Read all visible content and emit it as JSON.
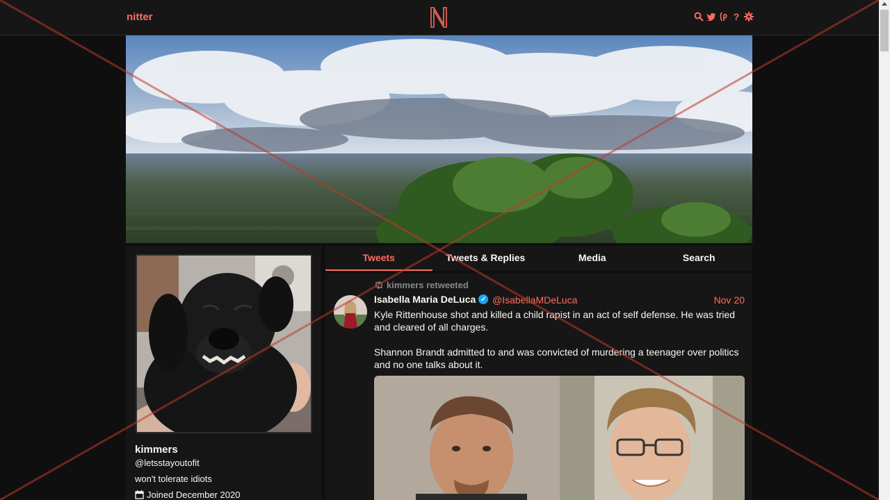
{
  "nav": {
    "brand": "nitter",
    "icons": [
      "search-icon",
      "twitter-bird-icon",
      "lp-icon",
      "help-icon",
      "gear-icon"
    ],
    "help_glyph": "?"
  },
  "profile": {
    "name": "kimmers",
    "handle": "@letsstayoutofit",
    "bio": "won't tolerate idiots",
    "joined": "Joined December 2020"
  },
  "tabs": [
    {
      "label": "Tweets",
      "active": true
    },
    {
      "label": "Tweets & Replies",
      "active": false
    },
    {
      "label": "Media",
      "active": false
    },
    {
      "label": "Search",
      "active": false
    }
  ],
  "tweet": {
    "retweet_label": "kimmers retweeted",
    "author_name": "Isabella Maria DeLuca",
    "author_handle": "@IsabellaMDeLuca",
    "date": "Nov 20",
    "paragraphs": [
      "Kyle Rittenhouse shot and killed a child rapist in an act of self defense. He was tried and cleared of all charges.",
      "Shannon Brandt admitted to and was convicted of murdering a teenager over politics and no one talks about it."
    ]
  },
  "colors": {
    "accent": "#ff6c60",
    "background": "#0f0f0f",
    "panel": "#161616",
    "verified": "#1da1f2"
  }
}
